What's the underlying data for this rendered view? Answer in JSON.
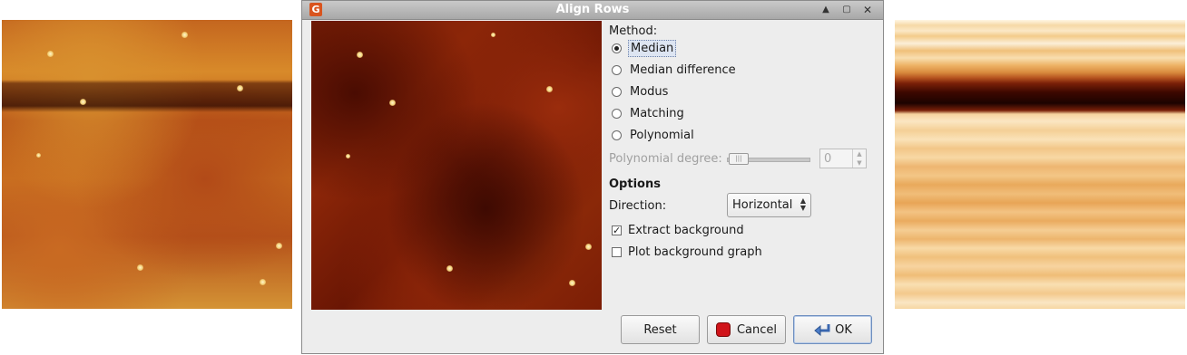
{
  "dialog": {
    "title": "Align Rows",
    "app_icon_letter": "G"
  },
  "method": {
    "label": "Method:",
    "options": [
      {
        "label": "Median",
        "selected": true
      },
      {
        "label": "Median difference",
        "selected": false
      },
      {
        "label": "Modus",
        "selected": false
      },
      {
        "label": "Matching",
        "selected": false
      },
      {
        "label": "Polynomial",
        "selected": false
      }
    ]
  },
  "polynomial": {
    "label": "Polynomial degree:",
    "value": "0",
    "slider_value": 0,
    "enabled": false
  },
  "options": {
    "heading": "Options",
    "direction_label": "Direction:",
    "direction_value": "Horizontal",
    "extract_background": {
      "label": "Extract background",
      "checked": true
    },
    "plot_background": {
      "label": "Plot background graph",
      "checked": false
    }
  },
  "buttons": {
    "reset": "Reset",
    "cancel": "Cancel",
    "ok": "OK"
  },
  "colors": {
    "titlebar": "#b0b0b0",
    "dialog_bg": "#ededed",
    "cancel_icon": "#d0141a",
    "ok_icon": "#4a7cc9"
  },
  "icons": {
    "app": "gwyddion-icon",
    "cancel": "stop-icon",
    "ok": "return-arrow-icon"
  }
}
